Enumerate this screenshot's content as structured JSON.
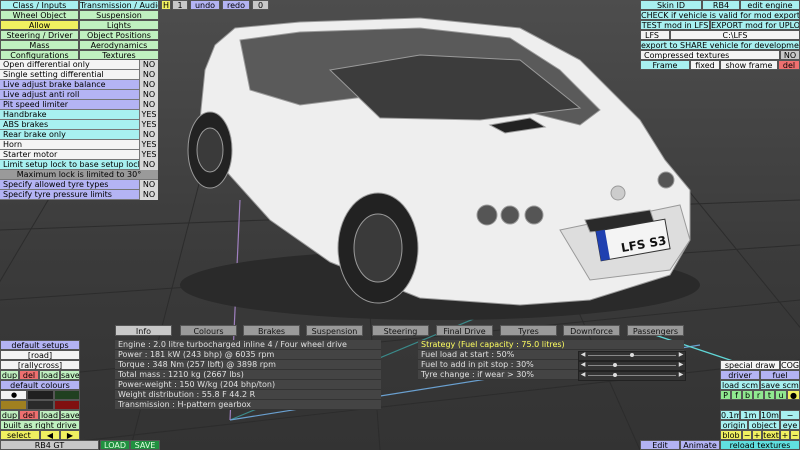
{
  "colors": {
    "panel_green": "#c0f0c0",
    "panel_blue": "#b4b4f4",
    "panel_cyan": "#a8f0f0",
    "delete_red": "#f07070",
    "active_yellow": "#f0f060",
    "info_panel_bg": "#444444",
    "strategy_text": "#ffff60"
  },
  "top_menu": {
    "class_inputs": "Class / Inputs",
    "transmission_audio": "Transmission / Audio",
    "wheel_object": "Wheel Object",
    "suspension": "Suspension",
    "allow": "Allow",
    "lights": "Lights",
    "steering_driver": "Steering / Driver",
    "object_positions": "Object Positions",
    "mass": "Mass",
    "aerodynamics": "Aerodynamics",
    "configurations": "Configurations",
    "textures": "Textures"
  },
  "toolbar": {
    "h": "H",
    "num": "1",
    "undo": "undo",
    "redo": "redo",
    "zero": "0"
  },
  "options": [
    {
      "label": "Open differential only",
      "value": "NO"
    },
    {
      "label": "Single setting differential",
      "value": "NO"
    },
    {
      "label": "Live adjust brake balance",
      "value": "NO"
    },
    {
      "label": "Live adjust anti roll",
      "value": "NO"
    },
    {
      "label": "Pit speed limiter",
      "value": "NO"
    },
    {
      "label": "Handbrake",
      "value": "YES"
    },
    {
      "label": "ABS brakes",
      "value": "YES"
    },
    {
      "label": "Rear brake only",
      "value": "NO"
    },
    {
      "label": "Horn",
      "value": "YES"
    },
    {
      "label": "Starter motor",
      "value": "YES"
    },
    {
      "label": "Limit setup lock to base setup lock",
      "value": "NO"
    }
  ],
  "max_lock": "Maximum lock is limited to 30°",
  "tyre_options": [
    {
      "label": "Specify allowed tyre types",
      "value": "NO"
    },
    {
      "label": "Specify tyre pressure limits",
      "value": "NO"
    }
  ],
  "right_panel": {
    "skin_id": "Skin ID",
    "skin_value": "RB4",
    "edit_engine": "edit engine",
    "check_valid": "CHECK if vehicle is valid for mod export",
    "test_mod": "TEST mod in LFS",
    "export_mod": "EXPORT mod for UPLOAD",
    "lfs": "LFS",
    "path": "C:\\LFS",
    "export_share": "export to SHARE vehicle for development",
    "compressed_textures": "Compressed textures",
    "compressed_value": "NO",
    "frame": "Frame",
    "fixed": "fixed",
    "show_frame": "show frame",
    "del": "del"
  },
  "tabs": [
    "Info",
    "Colours",
    "Brakes",
    "Suspension",
    "Steering",
    "Final Drive",
    "Tyres",
    "Downforce",
    "Passengers"
  ],
  "info_lines": [
    "Engine : 2.0 litre turbocharged inline 4 / Four wheel drive",
    "Power : 181 kW (243 bhp) @ 6035 rpm",
    "Torque : 348 Nm (257 lbft) @ 3898 rpm",
    "Total mass : 1210 kg (2667 lbs)",
    "Power-weight : 150 W/kg (204 bhp/ton)",
    "Weight distribution : 55.8 F  44.2 R",
    "Transmission : H-pattern gearbox"
  ],
  "strategy": {
    "title": "Strategy (Fuel capacity : 75.0 litres)",
    "rows": [
      {
        "label": "Fuel load at start : 50%",
        "level": 0.5
      },
      {
        "label": "Fuel to add in pit stop : 30%",
        "level": 0.3
      },
      {
        "label": "Tyre change : if wear > 30%",
        "level": 0.3
      }
    ]
  },
  "left_bottom": {
    "default_setups": "default setups",
    "road": "[road]",
    "rallycross": "[rallycross]",
    "dup": "dup",
    "del": "del",
    "load": "load",
    "save": "save",
    "default_colours": "default colours",
    "built_as_right_drive": "built as right drive",
    "select": "select",
    "car_name": "RB4 GT"
  },
  "bottom_bar": {
    "load": "LOAD",
    "save": "SAVE",
    "edit": "Edit",
    "animate": "Animate"
  },
  "right_bottom": {
    "special_draw": "special draw",
    "cog": "COG",
    "driver": "driver",
    "fuel": "fuel",
    "load_scm": "load scm",
    "save_scm": "save scm",
    "letters": [
      "P",
      "f",
      "b",
      "r",
      "t",
      "u",
      "●"
    ],
    "d01": "0.1m",
    "d1": "1m",
    "d10": "10m",
    "minus": "−",
    "origin": "origin",
    "object": "object",
    "eye": "eye",
    "blob": "blob",
    "text": "text",
    "reload_textures": "reload textures"
  },
  "car": {
    "plate": "LFS S3",
    "plate_country": "EU"
  }
}
